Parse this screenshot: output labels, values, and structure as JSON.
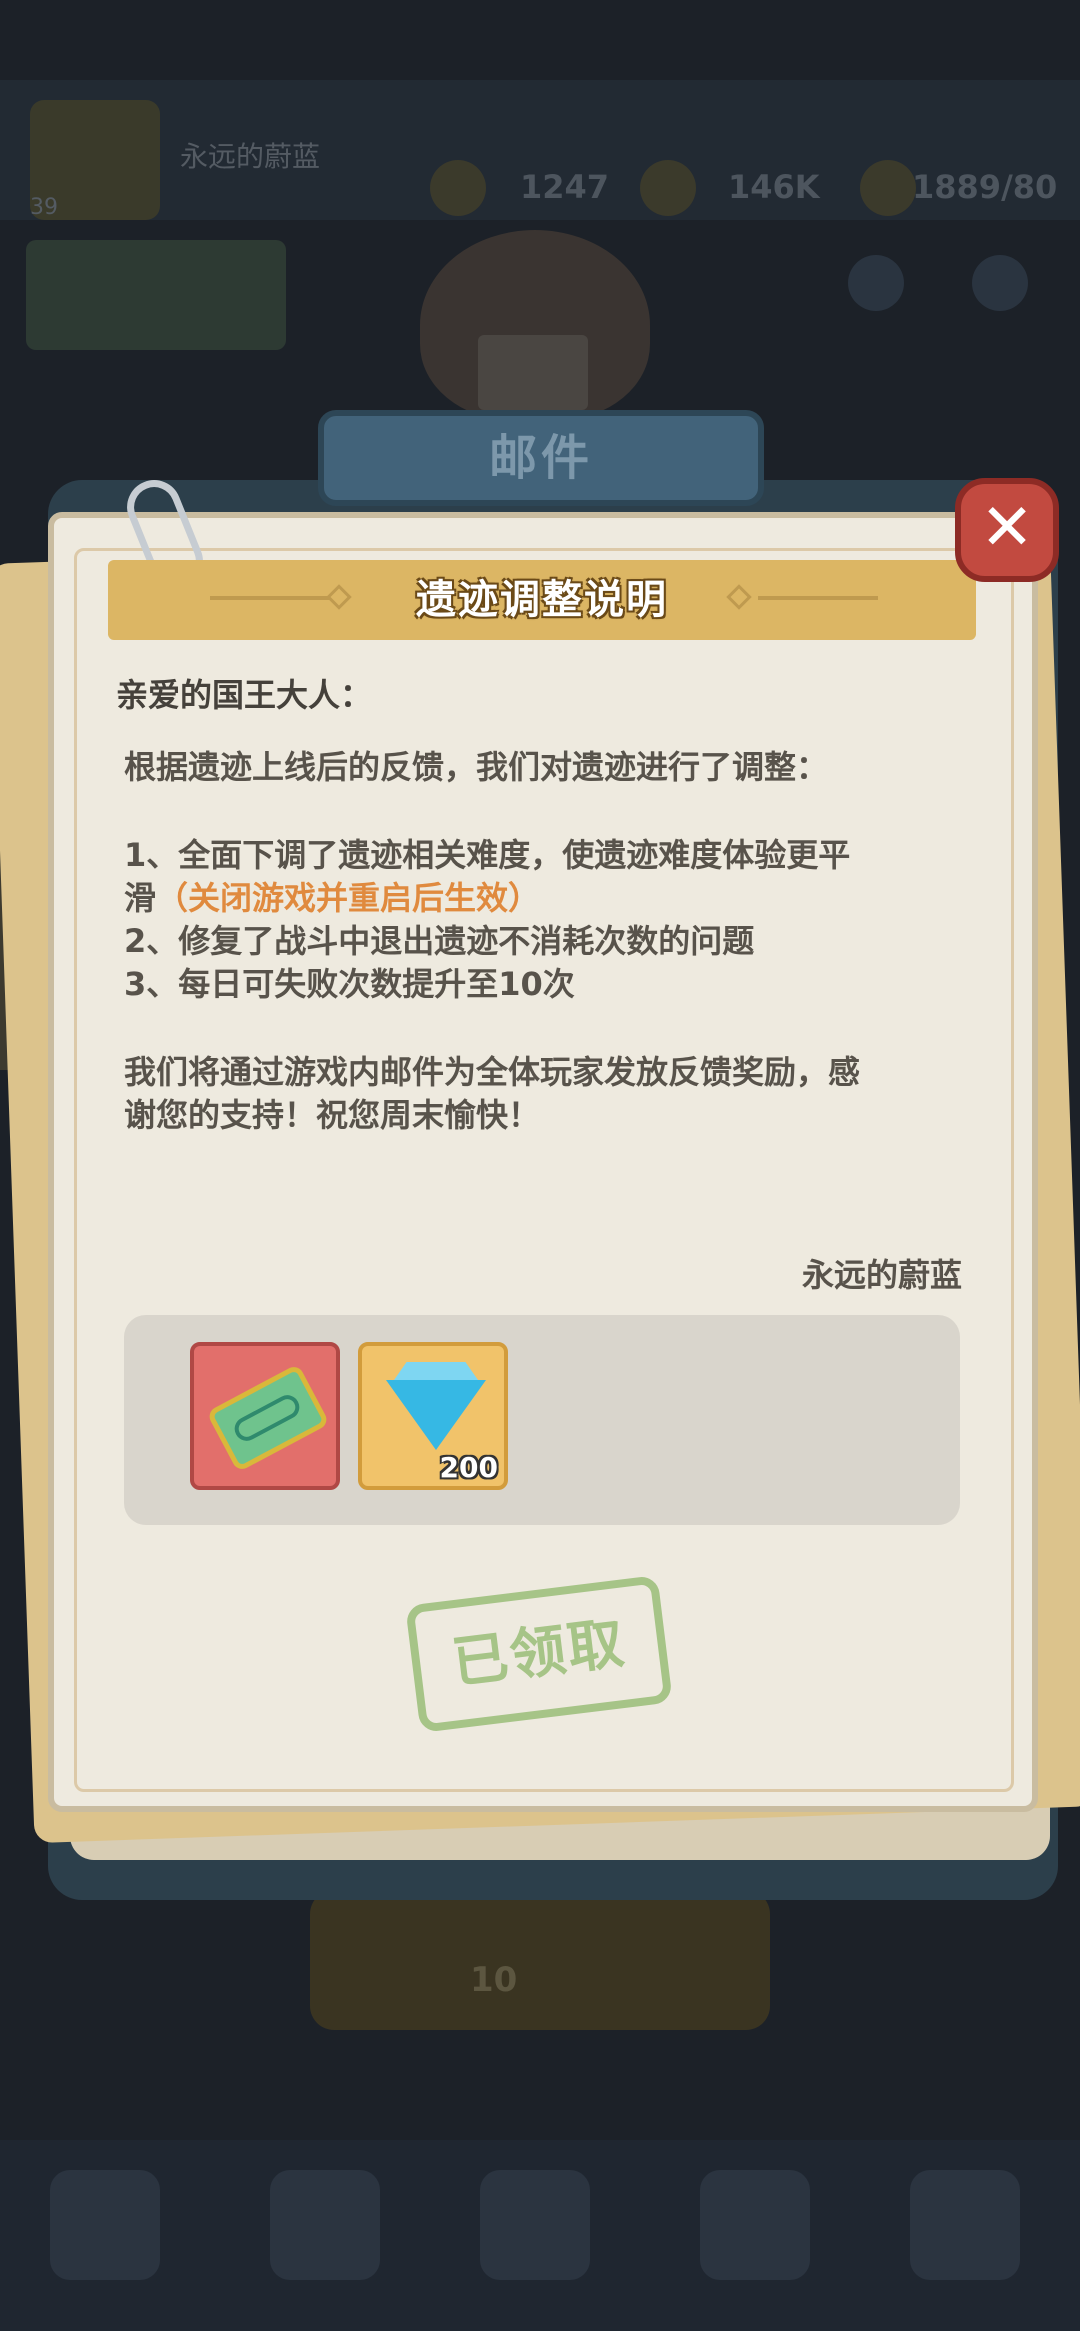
{
  "background": {
    "player_name": "永远的蔚蓝",
    "player_level": "39",
    "stat_1": "1247",
    "stat_2": "146K",
    "stat_3": "1889/80",
    "bottom_panel_text": "10"
  },
  "modal": {
    "header_title": "邮件",
    "close_icon": "✕",
    "mail_title": "遗迹调整说明",
    "greeting": "亲爱的国王大人：",
    "lines": [
      "根据遗迹上线后的反馈，我们对遗迹进行了调整：",
      "1、全面下调了遗迹相关难度，使遗迹难度体验更平",
      "滑",
      "（关闭游戏并重启后生效）",
      "2、修复了战斗中退出遗迹不消耗次数的问题",
      "3、每日可失败次数提升至10次",
      "我们将通过游戏内邮件为全体玩家发放反馈奖励，感",
      "谢您的支持！祝您周末愉快！"
    ],
    "signature": "永远的蔚蓝",
    "rewards": [
      {
        "icon": "ticket-icon",
        "count": ""
      },
      {
        "icon": "diamond-icon",
        "count": "200"
      }
    ],
    "claimed_label": "已领取"
  },
  "colors": {
    "highlight": "#e08a3e",
    "ribbon": "#dcb664",
    "close_button": "#c24a40",
    "claimed_stamp": "#a6c487"
  }
}
